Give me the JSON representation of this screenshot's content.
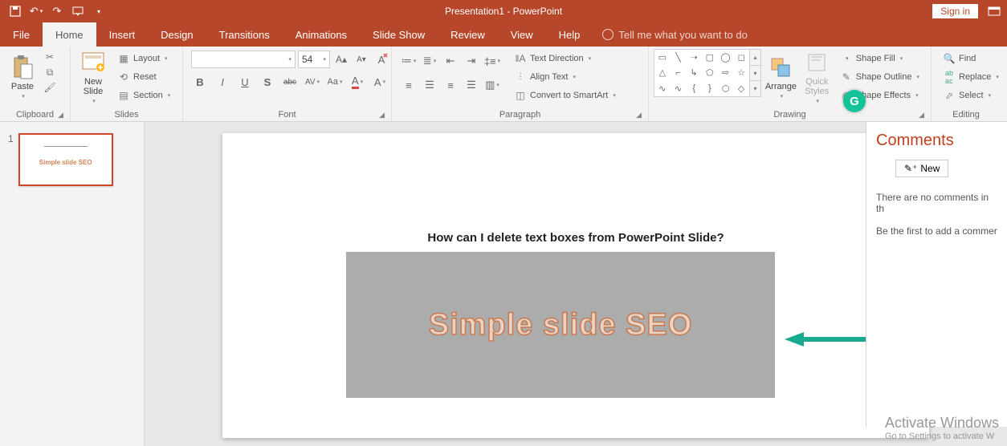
{
  "title": "Presentation1 - PowerPoint",
  "signin": "Sign in",
  "tabs": {
    "file": "File",
    "home": "Home",
    "insert": "Insert",
    "design": "Design",
    "transitions": "Transitions",
    "animations": "Animations",
    "slideshow": "Slide Show",
    "review": "Review",
    "view": "View",
    "help": "Help",
    "tellme": "Tell me what you want to do"
  },
  "clipboard": {
    "paste": "Paste",
    "label": "Clipboard"
  },
  "slides": {
    "new": "New\nSlide",
    "layout": "Layout",
    "reset": "Reset",
    "section": "Section",
    "label": "Slides"
  },
  "font": {
    "size": "54",
    "label": "Font",
    "bold": "B",
    "italic": "I",
    "underline": "U",
    "strike": "S",
    "shadow": "abc",
    "spacing": "AV",
    "case": "Aa",
    "clear": "A"
  },
  "paragraph": {
    "label": "Paragraph",
    "textdir": "Text Direction",
    "align": "Align Text",
    "smartart": "Convert to SmartArt"
  },
  "drawing": {
    "arrange": "Arrange",
    "quickstyles": "Quick\nStyles",
    "fill": "Shape Fill",
    "outline": "Shape Outline",
    "effects": "Shape Effects",
    "label": "Drawing"
  },
  "editing": {
    "find": "Find",
    "replace": "Replace",
    "select": "Select",
    "label": "Editing"
  },
  "thumb": {
    "num": "1",
    "text": "Simple slide SEO"
  },
  "slide": {
    "title": "How can I delete text boxes from PowerPoint Slide?",
    "seo": "Simple slide SEO"
  },
  "comments": {
    "heading": "Comments",
    "new": "New",
    "msg1": "There are no comments in th",
    "msg2": "Be the first to add a commer"
  },
  "watermark": {
    "title": "Activate Windows",
    "sub": "Go to Settings to activate W"
  }
}
